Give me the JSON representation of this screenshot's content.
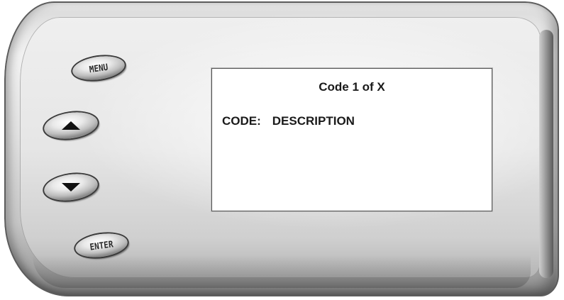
{
  "device": {
    "buttons": {
      "menu_label": "MENU",
      "up_icon": "up-arrow-icon",
      "down_icon": "down-arrow-icon",
      "enter_label": "ENTER"
    },
    "screen": {
      "title": "Code 1 of X",
      "code_label": "CODE:",
      "description_label": "DESCRIPTION"
    }
  }
}
